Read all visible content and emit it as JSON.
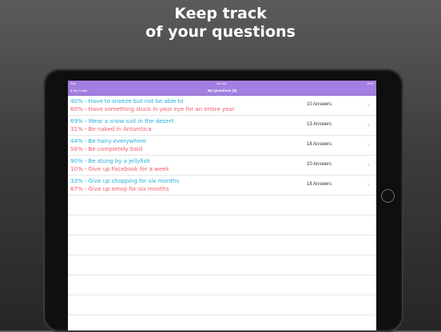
{
  "headline": {
    "line1": "Keep track",
    "line2": "of your questions"
  },
  "status_bar": {
    "left": "iPad",
    "time": "9:41 AM",
    "battery": "100%"
  },
  "nav": {
    "back_label": "My Profile",
    "title": "My Questions (5)"
  },
  "questions": [
    {
      "option_a": "40% - Have to sneeze but not be able to",
      "option_b": "60% - Have something stuck in your eye for an entire year",
      "answers": "10 Answers"
    },
    {
      "option_a": "69% - Wear a snow suit in the desert",
      "option_b": "31% - Be naked in Antarctica",
      "answers": "13 Answers"
    },
    {
      "option_a": "44% - Be hairy everywhere",
      "option_b": "56% - Be completely bald",
      "answers": "18 Answers"
    },
    {
      "option_a": "90% - Be stung by a jellyfish",
      "option_b": "10% - Give up Facebook for a week",
      "answers": "10 Answers"
    },
    {
      "option_a": "33% - Give up shopping for six months",
      "option_b": "67% - Give up emoji for six months",
      "answers": "18 Answers"
    }
  ],
  "colors": {
    "nav_bg": "#a27fe0",
    "option_a": "#2bb0dc",
    "option_b": "#ef5f6f"
  },
  "icons": {
    "back": "chevron-left-icon",
    "row": "chevron-right-icon"
  }
}
